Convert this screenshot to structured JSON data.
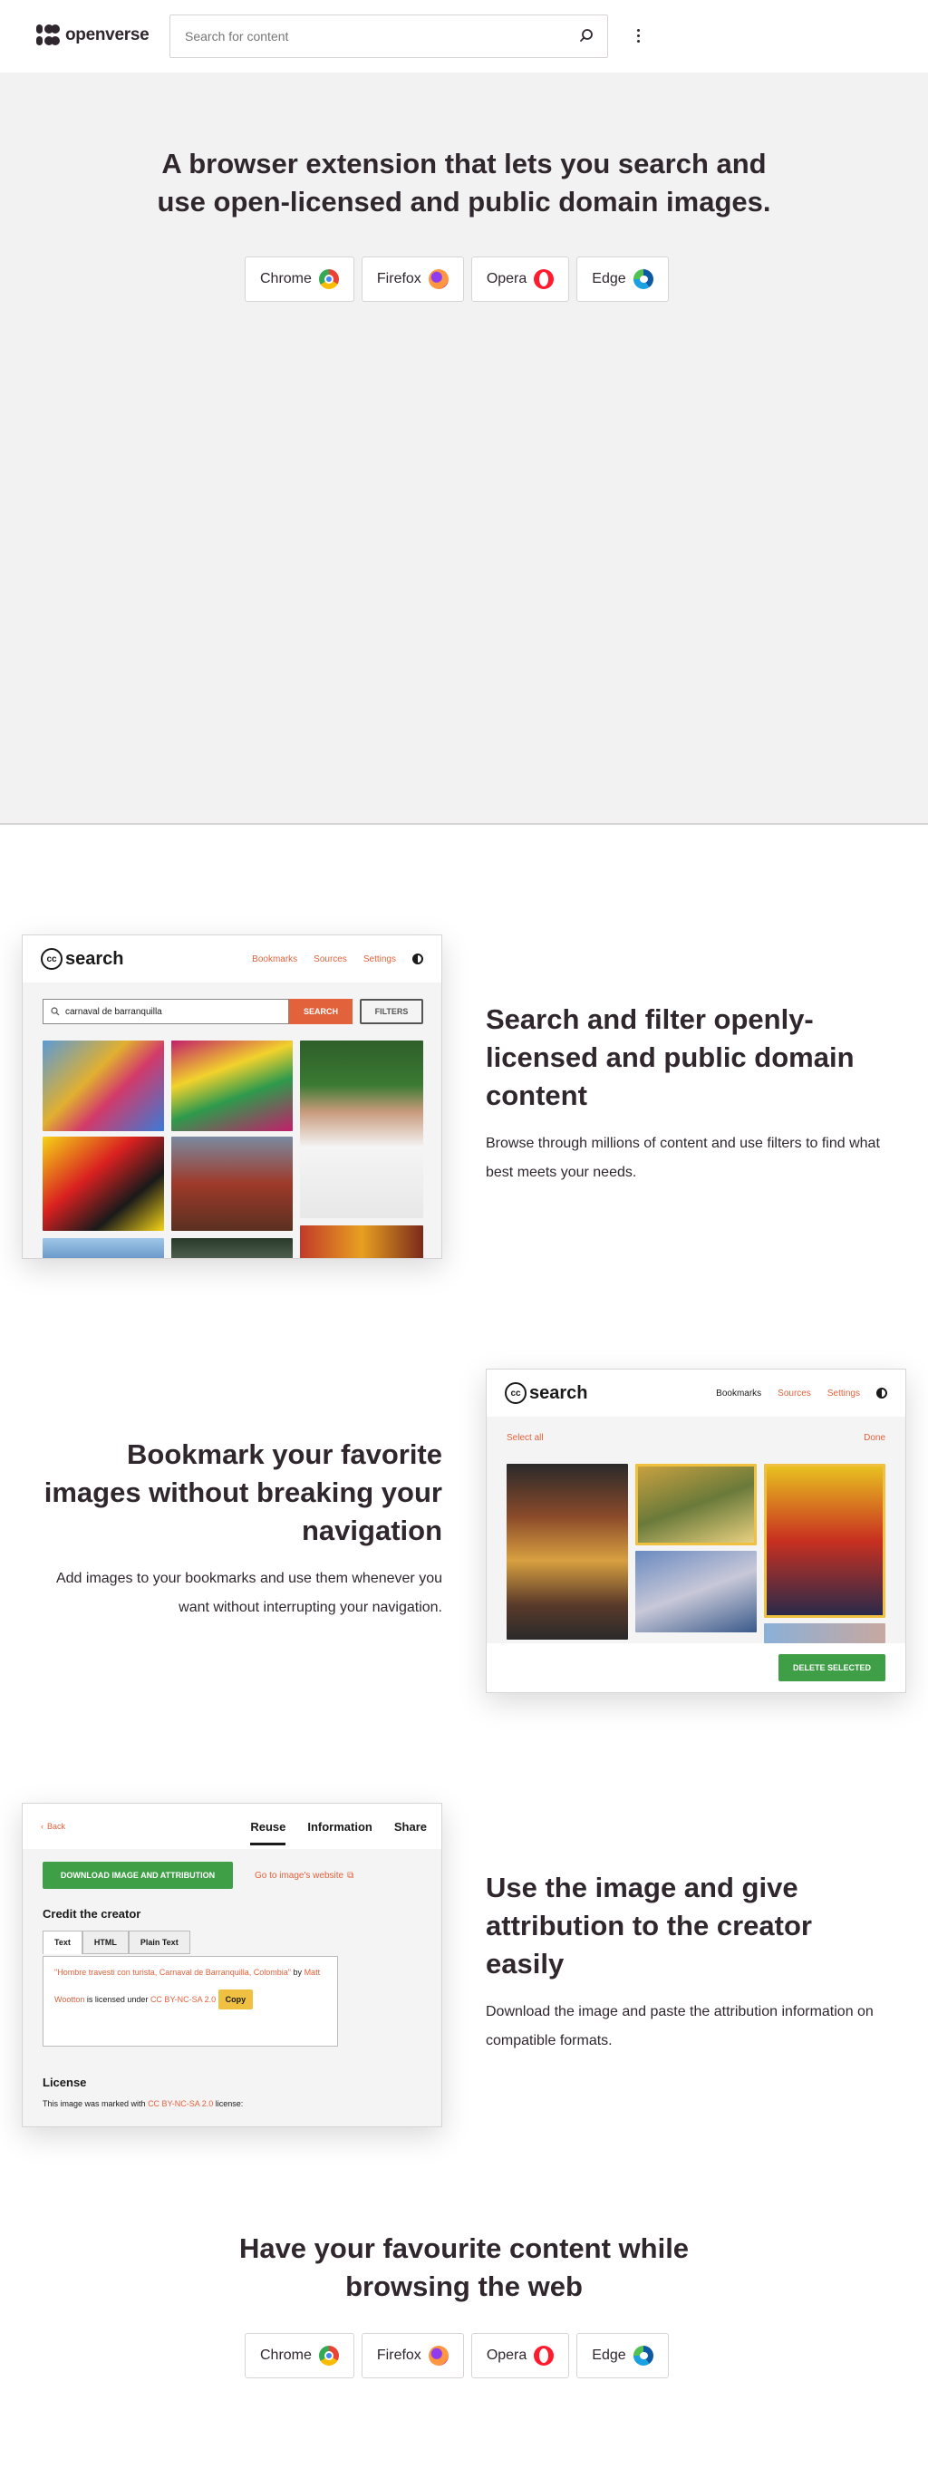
{
  "header": {
    "logo_text": "openverse",
    "search_placeholder": "Search for content",
    "search_icon": "search-icon",
    "menu_icon": "more-vertical-icon"
  },
  "hero": {
    "title_line1": "A browser extension that lets you search and",
    "title_line2": "use open-licensed and public domain images."
  },
  "browsers": [
    {
      "label": "Chrome",
      "icon": "chrome-icon"
    },
    {
      "label": "Firefox",
      "icon": "firefox-icon"
    },
    {
      "label": "Opera",
      "icon": "opera-icon"
    },
    {
      "label": "Edge",
      "icon": "edge-icon"
    }
  ],
  "feature_search": {
    "title_line1": "Search and filter openly-",
    "title_line2": "licensed and public domain",
    "title_line3": "content",
    "desc_line1": "Browse through millions of content and use filters to find what",
    "desc_line2": "best meets your needs.",
    "mock": {
      "logo": "search",
      "logo_cc": "cc",
      "nav": [
        "Bookmarks",
        "Sources",
        "Settings"
      ],
      "query": "carnaval de barranquilla",
      "search_btn": "SEARCH",
      "filters_btn": "FILTERS"
    }
  },
  "feature_bookmark": {
    "title_line1": "Bookmark your favorite",
    "title_line2": "images without breaking your",
    "title_line3": "navigation",
    "desc_line1": "Add images to your bookmarks and use them whenever you",
    "desc_line2": "want without interrupting your navigation.",
    "mock": {
      "logo": "search",
      "logo_cc": "cc",
      "nav": [
        "Bookmarks",
        "Sources",
        "Settings"
      ],
      "select_all": "Select all",
      "done": "Done",
      "delete_btn": "DELETE SELECTED"
    }
  },
  "feature_attribution": {
    "title_line1": "Use the image and give",
    "title_line2": "attribution to the creator",
    "title_line3": "easily",
    "desc_line1": "Download the image and paste the attribution information on",
    "desc_line2": "compatible formats.",
    "mock": {
      "back": "Back",
      "tabs": [
        "Reuse",
        "Information",
        "Share"
      ],
      "download_btn": "DOWNLOAD IMAGE AND ATTRIBUTION",
      "go_link": "Go to image's website",
      "credit_heading": "Credit the creator",
      "format_tabs": [
        "Text",
        "HTML",
        "Plain Text"
      ],
      "attr_title": "\"Hombre travesti con turista, Carnaval de Barranquilla, Colombia\"",
      "attr_by": "by",
      "attr_author": "Matt Wootton",
      "attr_licensed": "is licensed under",
      "attr_license": "CC BY-NC-SA 2.0",
      "copy_btn": "Copy",
      "license_heading": "License",
      "license_text_pre": "This image was marked with",
      "license_text_link": "CC BY-NC-SA 2.0",
      "license_text_post": "license:"
    }
  },
  "footer": {
    "title_line1": "Have your favourite content while",
    "title_line2": "browsing the web"
  }
}
